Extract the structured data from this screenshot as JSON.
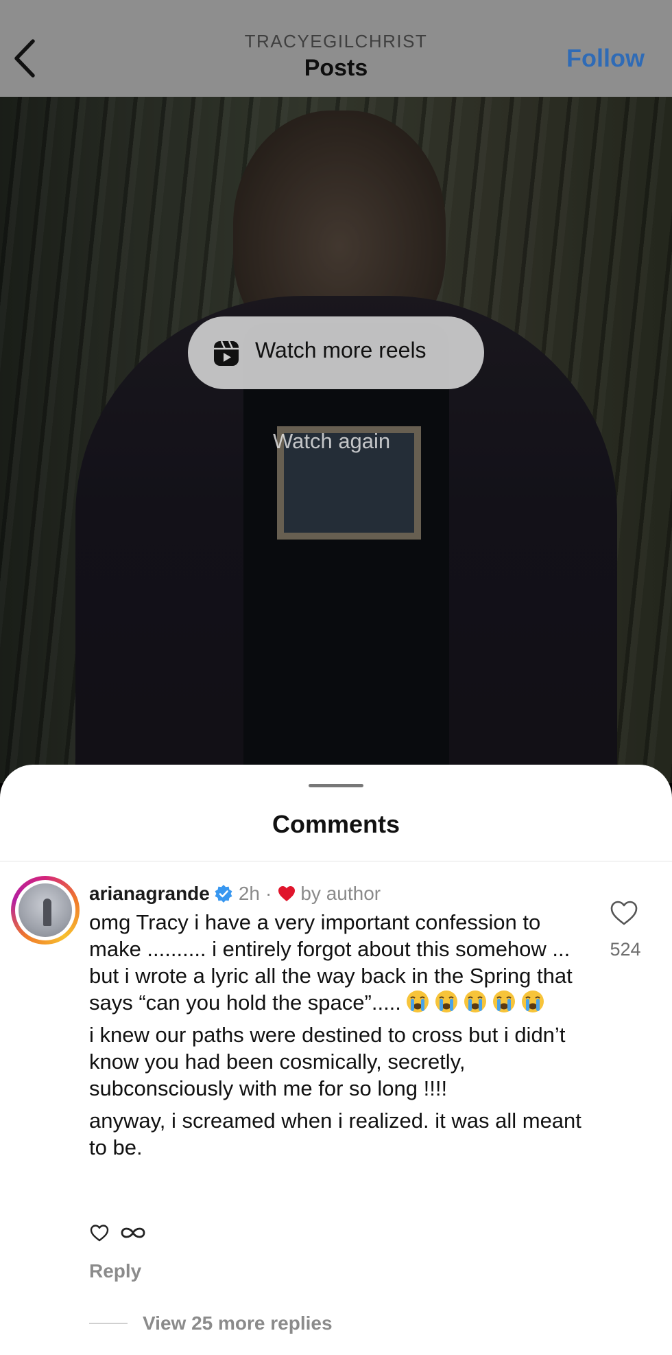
{
  "header": {
    "username": "TRACYEGILCHRIST",
    "title": "Posts",
    "follow_label": "Follow"
  },
  "video": {
    "watch_more_label": "Watch more reels",
    "watch_again_label": "Watch again"
  },
  "comments": {
    "title": "Comments",
    "items": [
      {
        "username": "arianagrande",
        "time": "2h",
        "separator": "·",
        "by_author": "by author",
        "paragraphs": [
          "omg Tracy i have a very important confession to make .......... i entirely forgot about this somehow ... but i wrote a lyric all the way back in the Spring that says “can you hold the space”.....",
          "i knew our paths were destined to cross but i didn’t know you had been cosmically, secretly, subconsciously with me for so long !!!!",
          "anyway, i screamed when i realized. it was all meant to be."
        ],
        "emoji_name": "loudly-crying-face",
        "like_count": "524",
        "reply_label": "Reply",
        "view_replies_label": "View 25 more replies"
      }
    ]
  },
  "colors": {
    "header_bg": "#8e8e8e",
    "follow": "#2f6bb6",
    "verified": "#3897f0",
    "heart": "#e0152c"
  }
}
